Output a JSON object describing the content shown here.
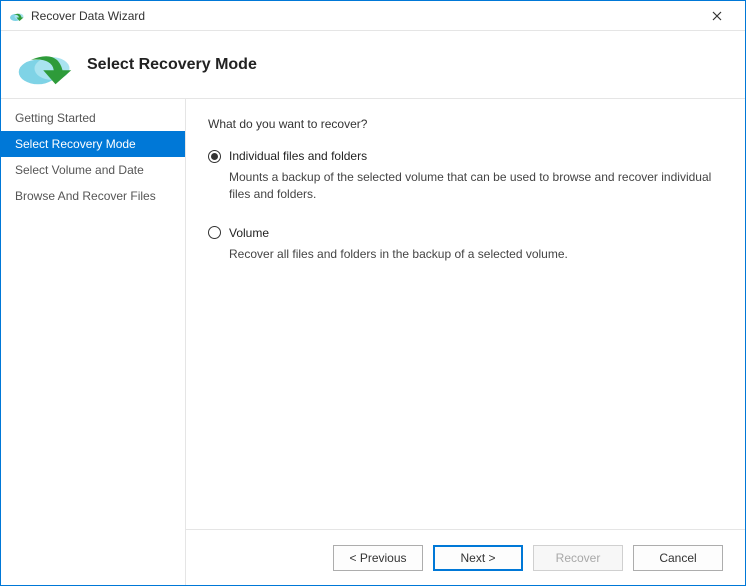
{
  "window": {
    "title": "Recover Data Wizard"
  },
  "header": {
    "title": "Select Recovery Mode"
  },
  "sidebar": {
    "items": [
      {
        "label": "Getting Started"
      },
      {
        "label": "Select Recovery Mode"
      },
      {
        "label": "Select Volume and Date"
      },
      {
        "label": "Browse And Recover Files"
      }
    ],
    "active_index": 1
  },
  "content": {
    "question": "What do you want to recover?",
    "options": [
      {
        "label": "Individual files and folders",
        "description": "Mounts a backup of the selected volume that can be used to browse and recover individual files and folders.",
        "selected": true
      },
      {
        "label": "Volume",
        "description": "Recover all files and folders in the backup of a selected volume.",
        "selected": false
      }
    ]
  },
  "footer": {
    "previous": "< Previous",
    "next": "Next >",
    "recover": "Recover",
    "cancel": "Cancel"
  }
}
